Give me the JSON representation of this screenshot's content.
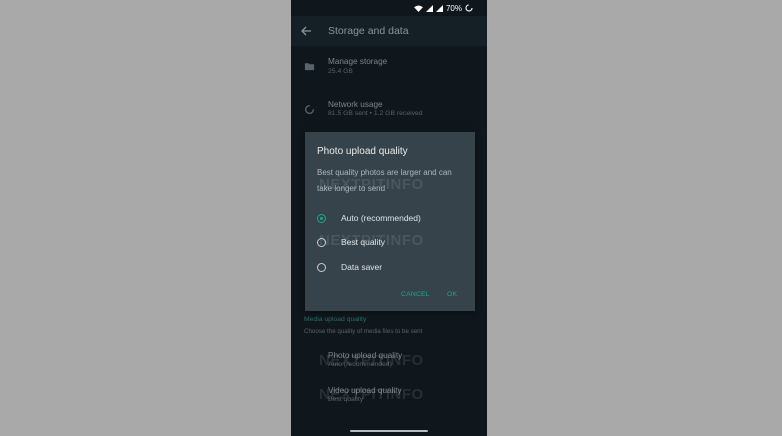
{
  "status_bar": {
    "battery": "70%"
  },
  "app_bar": {
    "title": "Storage and data"
  },
  "rows": [
    {
      "title": "Manage storage",
      "subtitle": "25.4 GB"
    },
    {
      "title": "Network usage",
      "subtitle": "81.5 GB sent • 1.2 GB received"
    }
  ],
  "media_section": {
    "header": "Media upload quality",
    "description": "Choose the quality of media files to be sent",
    "items": [
      {
        "title": "Photo upload quality",
        "subtitle": "Auto (recommended)"
      },
      {
        "title": "Video upload quality",
        "subtitle": "Best quality"
      }
    ]
  },
  "dialog": {
    "title": "Photo upload quality",
    "message": "Best quality photos are larger and can take longer to send",
    "options": [
      {
        "label": "Auto (recommended)",
        "selected": true
      },
      {
        "label": "Best quality",
        "selected": false
      },
      {
        "label": "Data saver",
        "selected": false
      }
    ],
    "cancel_label": "CANCEL",
    "ok_label": "OK"
  },
  "watermark": "NEXTPITINFO",
  "colors": {
    "background": "#a9a9a9",
    "screen": "#0f171d",
    "dialog": "#36434a",
    "accent": "#19a88f"
  }
}
